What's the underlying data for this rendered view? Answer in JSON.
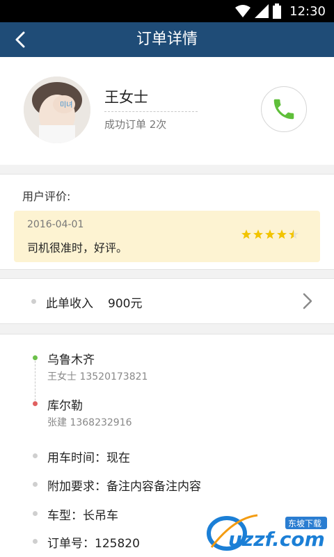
{
  "status_bar": {
    "time": "12:30"
  },
  "header": {
    "title": "订单详情"
  },
  "profile": {
    "name": "王女士",
    "orders_summary": "成功订单 2次",
    "avatar_caption": "미녀"
  },
  "review": {
    "label": "用户评价:",
    "date": "2016-04-01",
    "text": "司机很准时，好评。",
    "rating": 4.5,
    "rating_max": 5,
    "star_color": "#f2c400"
  },
  "income": {
    "label": "此单收入",
    "value": "900元"
  },
  "route": {
    "origin": {
      "place": "乌鲁木齐",
      "contact": "王女士 13520173821"
    },
    "destination": {
      "place": "库尔勒",
      "contact": "张建 1368232916"
    }
  },
  "info": [
    "用车时间：现在",
    "附加要求：备注内容备注内容",
    "车型：长吊车",
    "订单号：125820"
  ],
  "watermark": {
    "text": "uzzf.com",
    "subtext": "东坡下载"
  },
  "colors": {
    "header": "#1f4c77",
    "call_icon": "#5fbf3a",
    "accent_green": "#6cc04a",
    "accent_red": "#e06060"
  }
}
